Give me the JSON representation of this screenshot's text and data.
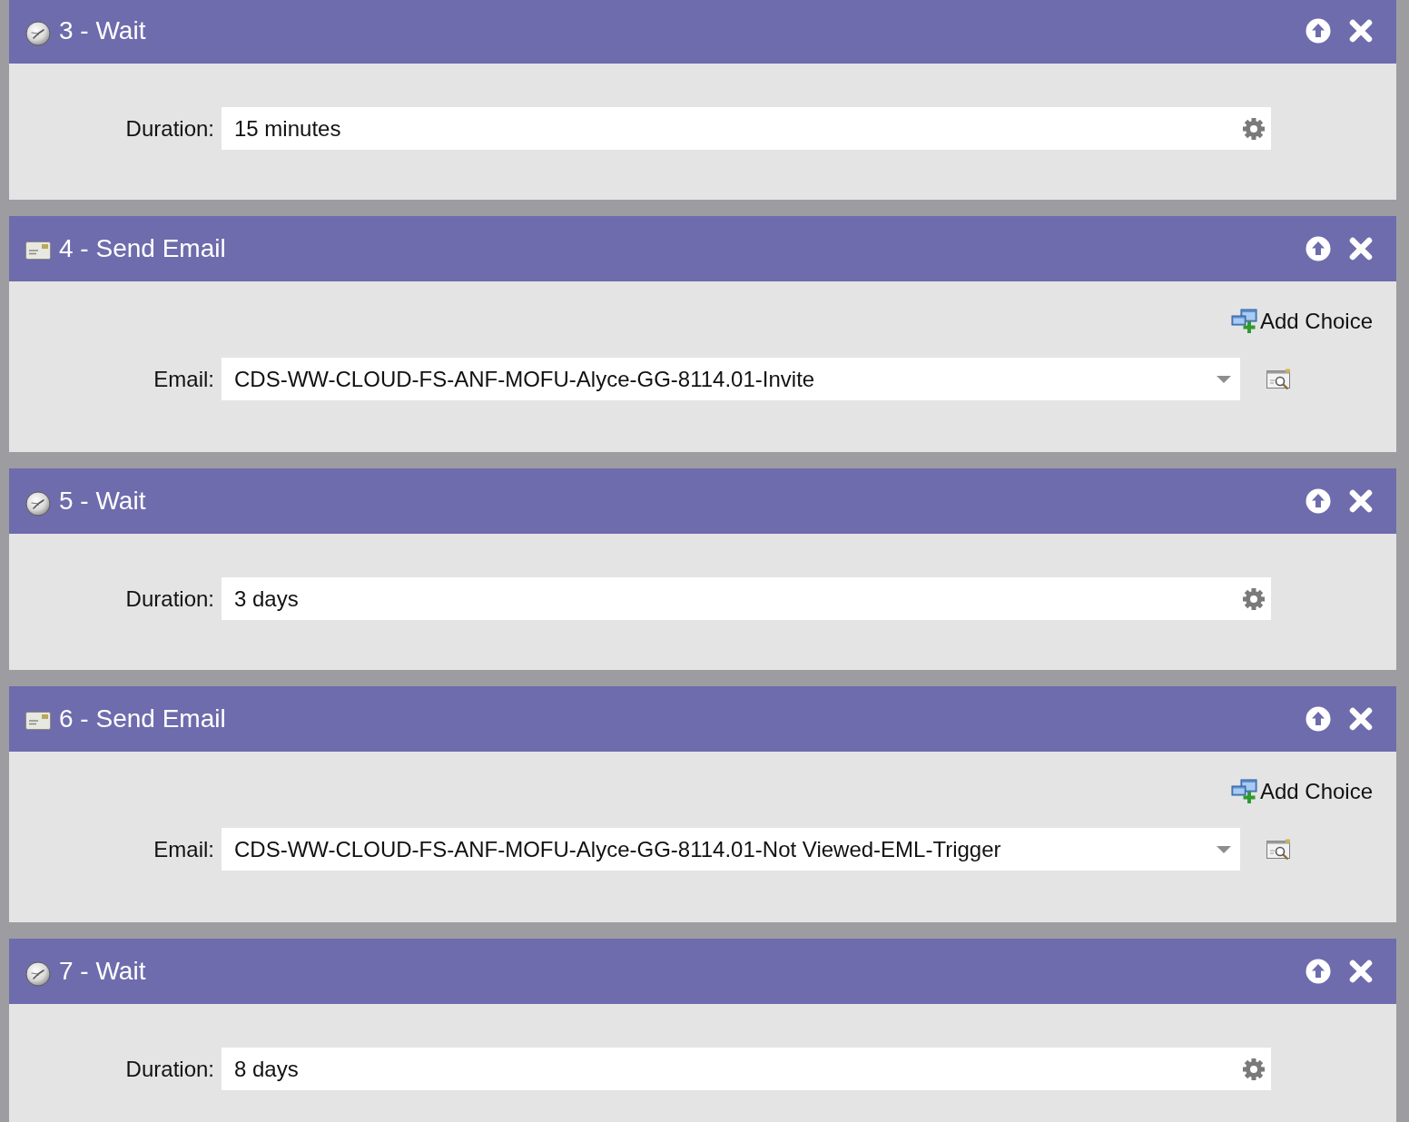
{
  "steps": [
    {
      "kind": "wait",
      "title": "3 - Wait",
      "label": "Duration:",
      "value": "15 minutes"
    },
    {
      "kind": "email",
      "title": "4 - Send Email",
      "add_choice": "Add Choice",
      "label": "Email:",
      "value": "CDS-WW-CLOUD-FS-ANF-MOFU-Alyce-GG-8114.01-Invite"
    },
    {
      "kind": "wait",
      "title": "5 - Wait",
      "label": "Duration:",
      "value": "3 days"
    },
    {
      "kind": "email",
      "title": "6 - Send Email",
      "add_choice": "Add Choice",
      "label": "Email:",
      "value": "CDS-WW-CLOUD-FS-ANF-MOFU-Alyce-GG-8114.01-Not Viewed-EML-Trigger"
    },
    {
      "kind": "wait",
      "title": "7 - Wait",
      "label": "Duration:",
      "value": "8 days"
    }
  ]
}
